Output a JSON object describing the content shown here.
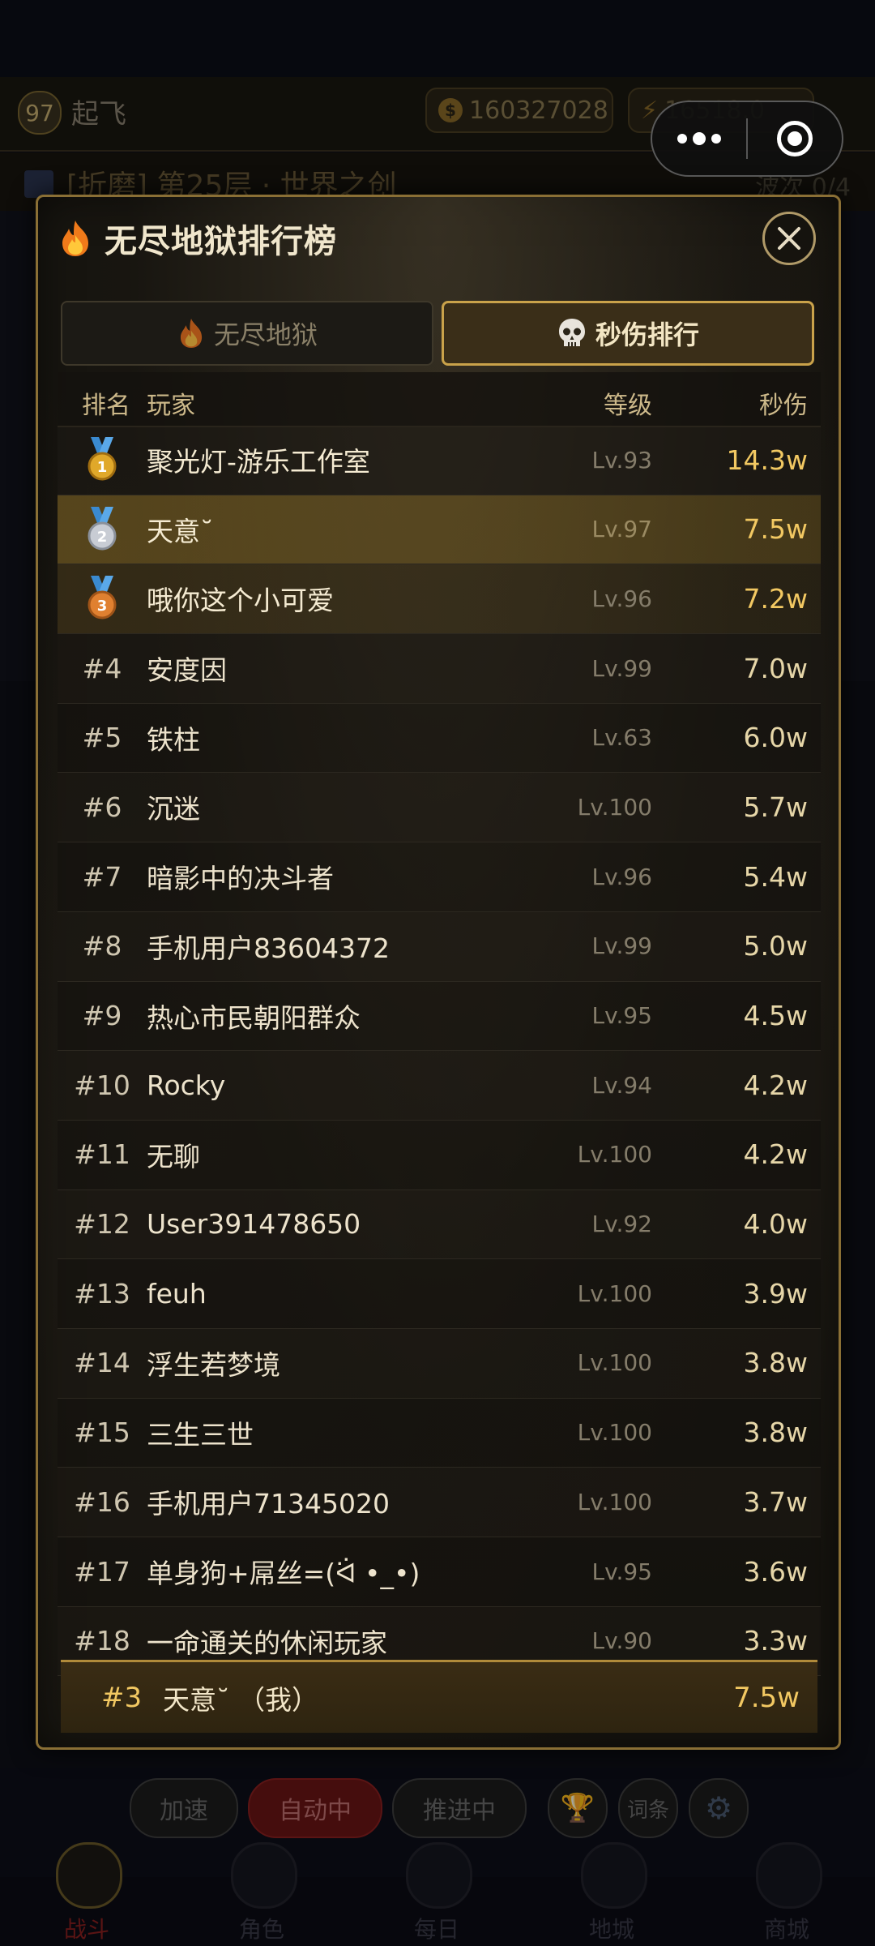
{
  "background": {
    "player": {
      "level": "97",
      "name": "起飞"
    },
    "gold": "160327028",
    "power": "16518.0",
    "stage": "[折磨] 第25层 · 世界之创",
    "wave": "波次 0/4",
    "buttons": {
      "speed": "加速",
      "auto": "自动中",
      "push": "推进中",
      "affix": "词条"
    },
    "tabs": [
      "战斗",
      "角色",
      "每日",
      "地城",
      "商城"
    ]
  },
  "modal": {
    "title": "无尽地狱排行榜",
    "tabs": [
      {
        "label": "无尽地狱",
        "active": false
      },
      {
        "label": "秒伤排行",
        "active": true
      }
    ],
    "columns": {
      "rank": "排名",
      "player": "玩家",
      "level": "等级",
      "dps": "秒伤"
    },
    "rows": [
      {
        "rank": "1",
        "name": "聚光灯-游乐工作室",
        "level": "Lv.93",
        "dps": "14.3w"
      },
      {
        "rank": "2",
        "name": "天意˘",
        "level": "Lv.97",
        "dps": "7.5w"
      },
      {
        "rank": "3",
        "name": "哦你这个小可爱",
        "level": "Lv.96",
        "dps": "7.2w"
      },
      {
        "rank": "#4",
        "name": "安度因",
        "level": "Lv.99",
        "dps": "7.0w"
      },
      {
        "rank": "#5",
        "name": "铁柱",
        "level": "Lv.63",
        "dps": "6.0w"
      },
      {
        "rank": "#6",
        "name": "沉迷",
        "level": "Lv.100",
        "dps": "5.7w"
      },
      {
        "rank": "#7",
        "name": "暗影中的决斗者",
        "level": "Lv.96",
        "dps": "5.4w"
      },
      {
        "rank": "#8",
        "name": "手机用户83604372",
        "level": "Lv.99",
        "dps": "5.0w"
      },
      {
        "rank": "#9",
        "name": "热心市民朝阳群众",
        "level": "Lv.95",
        "dps": "4.5w"
      },
      {
        "rank": "#10",
        "name": "Rocky",
        "level": "Lv.94",
        "dps": "4.2w"
      },
      {
        "rank": "#11",
        "name": "无聊",
        "level": "Lv.100",
        "dps": "4.2w"
      },
      {
        "rank": "#12",
        "name": "User391478650",
        "level": "Lv.92",
        "dps": "4.0w"
      },
      {
        "rank": "#13",
        "name": "feuh",
        "level": "Lv.100",
        "dps": "3.9w"
      },
      {
        "rank": "#14",
        "name": "浮生若梦境",
        "level": "Lv.100",
        "dps": "3.8w"
      },
      {
        "rank": "#15",
        "name": "三生三世",
        "level": "Lv.100",
        "dps": "3.8w"
      },
      {
        "rank": "#16",
        "name": "手机用户71345020",
        "level": "Lv.100",
        "dps": "3.7w"
      },
      {
        "rank": "#17",
        "name": "单身狗+屌丝=(ᐛ •_•)",
        "level": "Lv.95",
        "dps": "3.6w"
      },
      {
        "rank": "#18",
        "name": "一命通关的休闲玩家",
        "level": "Lv.90",
        "dps": "3.3w"
      }
    ],
    "my_row": {
      "rank": "#3",
      "name": "天意˘ （我）",
      "dps": "7.5w"
    }
  },
  "colors": {
    "gold_accent": "#f2c862",
    "border": "#8a6f35",
    "active_tab_border": "#c9a24a"
  }
}
